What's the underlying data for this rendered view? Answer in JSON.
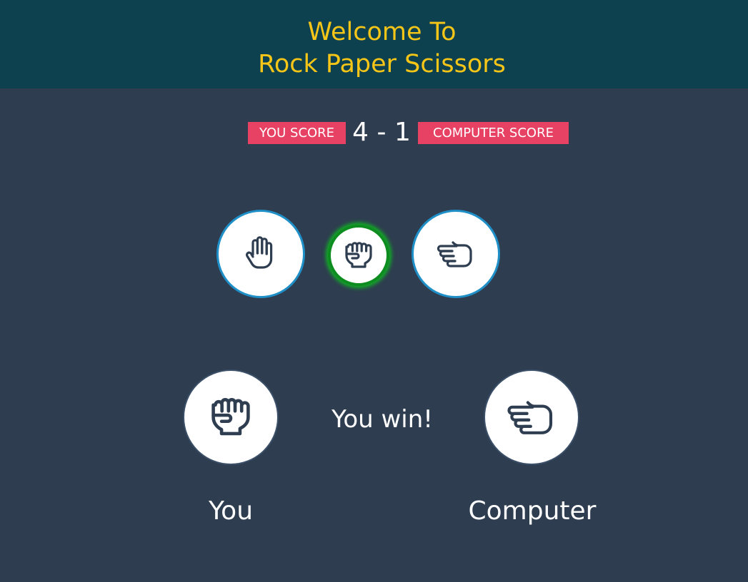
{
  "header": {
    "title_line1": "Welcome To",
    "title_line2": "Rock Paper Scissors"
  },
  "scoreboard": {
    "you_label": "YOU SCORE",
    "score_text": "4 - 1",
    "you_score": 4,
    "computer_score": 1,
    "computer_label": "COMPUTER SCORE"
  },
  "choices": [
    {
      "name": "paper",
      "icon": "open-hand-icon",
      "selected": false
    },
    {
      "name": "rock",
      "icon": "fist-icon",
      "selected": true
    },
    {
      "name": "scissors",
      "icon": "scissors-hand-icon",
      "selected": false
    }
  ],
  "result": {
    "message": "You win!",
    "player_label": "You",
    "computer_label": "Computer",
    "player_choice_icon": "fist-icon",
    "computer_choice_icon": "scissors-hand-icon"
  },
  "colors": {
    "background": "#2e3d50",
    "header_bg": "#0e414f",
    "title": "#f5c518",
    "score_label_bg": "#e74264",
    "choice_border": "#1f8fc8",
    "selected_border": "#0d8d1f",
    "icon_stroke": "#2e3d50"
  }
}
